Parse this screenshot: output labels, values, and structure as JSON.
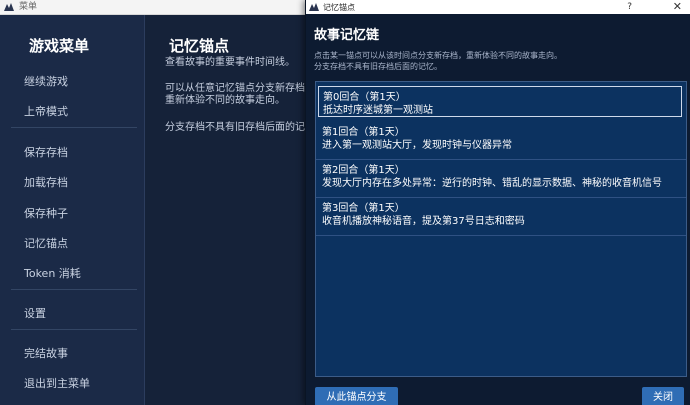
{
  "back_window": {
    "title": "菜单",
    "sidebar": {
      "title": "游戏菜单",
      "items": [
        "继续游戏",
        "上帝模式",
        "保存存档",
        "加载存档",
        "保存种子",
        "记忆锚点",
        "Token 消耗",
        "设置",
        "完结故事",
        "退出到主菜单"
      ]
    },
    "main": {
      "title": "记忆锚点",
      "lines": [
        "查看故事的重要事件时间线。",
        "可以从任意记忆锚点分支新存档，",
        "重新体验不同的故事走向。",
        "分支存档不具有旧存档后面的记忆。"
      ]
    }
  },
  "dialog": {
    "title": "记忆锚点",
    "help": "?",
    "close": "✕",
    "heading": "故事记忆链",
    "desc": [
      "点击某一锚点可以从该时间点分支新存档，重新体验不同的故事走向。",
      "分支存档不具有旧存档后面的记忆。"
    ],
    "entries": [
      {
        "turn": "第0回合（第1天）",
        "desc": "抵达时序迷城第一观测站"
      },
      {
        "turn": "第1回合（第1天）",
        "desc": "进入第一观测站大厅，发现时钟与仪器异常"
      },
      {
        "turn": "第2回合（第1天）",
        "desc": "发现大厅内存在多处异常：逆行的时钟、错乱的显示数据、神秘的收音机信号"
      },
      {
        "turn": "第3回合（第1天）",
        "desc": "收音机播放神秘语音，提及第37号日志和密码"
      }
    ],
    "branch_button": "从此锚点分支",
    "close_button": "关闭"
  }
}
